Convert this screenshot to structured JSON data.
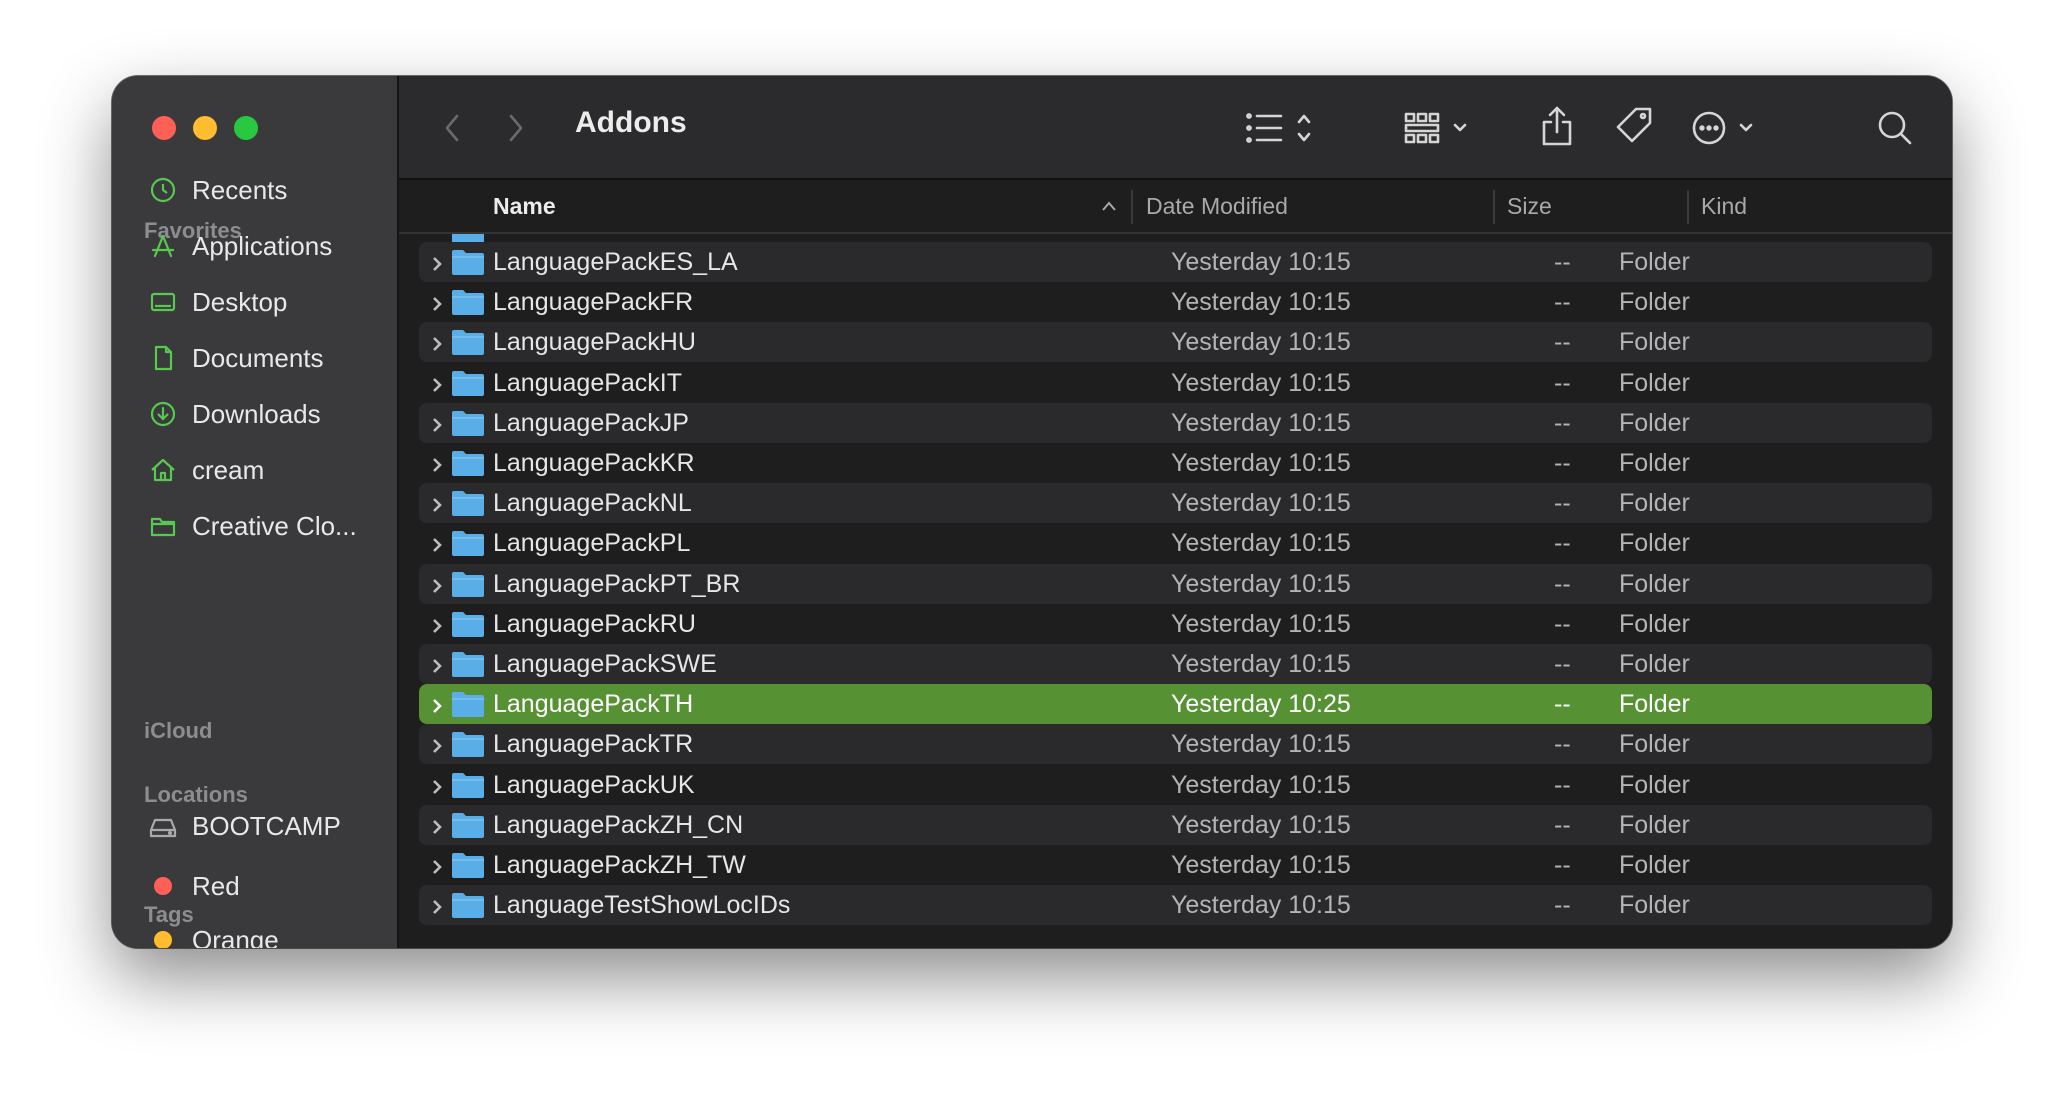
{
  "window": {
    "title": "Addons"
  },
  "sidebar": {
    "favorites_label": "Favorites",
    "favorites": [
      {
        "label": "Recents",
        "icon": "clock-icon"
      },
      {
        "label": "Applications",
        "icon": "applications-icon"
      },
      {
        "label": "Desktop",
        "icon": "desktop-icon"
      },
      {
        "label": "Documents",
        "icon": "document-icon"
      },
      {
        "label": "Downloads",
        "icon": "download-icon"
      },
      {
        "label": "cream",
        "icon": "home-icon"
      },
      {
        "label": "Creative Clo...",
        "icon": "folder-icon"
      }
    ],
    "icloud_label": "iCloud",
    "locations_label": "Locations",
    "locations": [
      {
        "label": "BOOTCAMP",
        "icon": "disk-icon"
      }
    ],
    "tags_label": "Tags",
    "tags": [
      {
        "label": "Red",
        "color": "#fe5f57"
      },
      {
        "label": "Orange",
        "color": "#febc2e"
      }
    ]
  },
  "columns": {
    "name": "Name",
    "date": "Date Modified",
    "size": "Size",
    "kind": "Kind"
  },
  "files": [
    {
      "name": "LanguagePackES_LA",
      "date": "Yesterday 10:15",
      "size": "--",
      "kind": "Folder"
    },
    {
      "name": "LanguagePackFR",
      "date": "Yesterday 10:15",
      "size": "--",
      "kind": "Folder"
    },
    {
      "name": "LanguagePackHU",
      "date": "Yesterday 10:15",
      "size": "--",
      "kind": "Folder"
    },
    {
      "name": "LanguagePackIT",
      "date": "Yesterday 10:15",
      "size": "--",
      "kind": "Folder"
    },
    {
      "name": "LanguagePackJP",
      "date": "Yesterday 10:15",
      "size": "--",
      "kind": "Folder"
    },
    {
      "name": "LanguagePackKR",
      "date": "Yesterday 10:15",
      "size": "--",
      "kind": "Folder"
    },
    {
      "name": "LanguagePackNL",
      "date": "Yesterday 10:15",
      "size": "--",
      "kind": "Folder"
    },
    {
      "name": "LanguagePackPL",
      "date": "Yesterday 10:15",
      "size": "--",
      "kind": "Folder"
    },
    {
      "name": "LanguagePackPT_BR",
      "date": "Yesterday 10:15",
      "size": "--",
      "kind": "Folder"
    },
    {
      "name": "LanguagePackRU",
      "date": "Yesterday 10:15",
      "size": "--",
      "kind": "Folder"
    },
    {
      "name": "LanguagePackSWE",
      "date": "Yesterday 10:15",
      "size": "--",
      "kind": "Folder"
    },
    {
      "name": "LanguagePackTH",
      "date": "Yesterday 10:25",
      "size": "--",
      "kind": "Folder",
      "selected": true
    },
    {
      "name": "LanguagePackTR",
      "date": "Yesterday 10:15",
      "size": "--",
      "kind": "Folder"
    },
    {
      "name": "LanguagePackUK",
      "date": "Yesterday 10:15",
      "size": "--",
      "kind": "Folder"
    },
    {
      "name": "LanguagePackZH_CN",
      "date": "Yesterday 10:15",
      "size": "--",
      "kind": "Folder"
    },
    {
      "name": "LanguagePackZH_TW",
      "date": "Yesterday 10:15",
      "size": "--",
      "kind": "Folder"
    },
    {
      "name": "LanguageTestShowLocIDs",
      "date": "Yesterday 10:15",
      "size": "--",
      "kind": "Folder"
    }
  ],
  "colors": {
    "selection": "#569134",
    "sidebar_icon": "#56c94e",
    "folder": "#5aaee8"
  }
}
